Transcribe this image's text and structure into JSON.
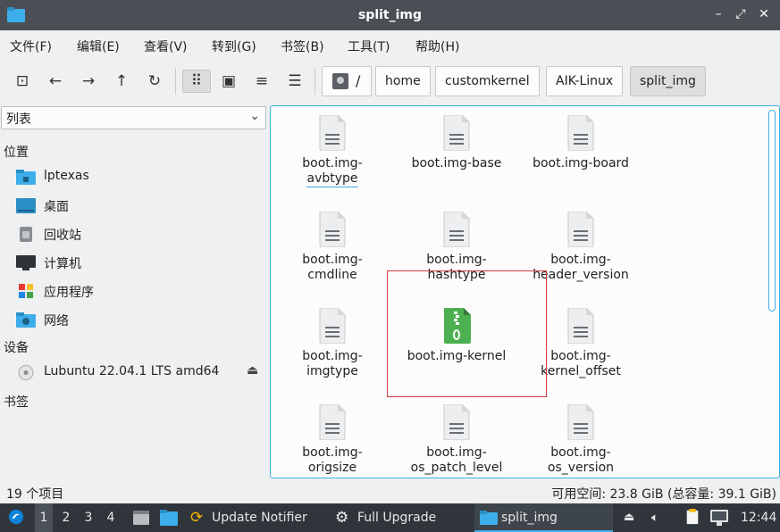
{
  "window": {
    "title": "split_img",
    "icon": "folder-icon",
    "controls": [
      "minimize-icon",
      "maximize-icon",
      "close-icon"
    ],
    "control_glyphs": [
      "–",
      "⤢",
      "✕"
    ]
  },
  "menu": {
    "items": [
      "文件(F)",
      "编辑(E)",
      "查看(V)",
      "转到(G)",
      "书签(B)",
      "工具(T)",
      "帮助(H)"
    ]
  },
  "toolbar": {
    "buttons": [
      {
        "name": "new-tab-icon",
        "glyph": "⊡"
      },
      {
        "name": "back-arrow-icon",
        "glyph": "←"
      },
      {
        "name": "forward-arrow-icon",
        "glyph": "→"
      },
      {
        "name": "up-arrow-icon",
        "glyph": "↑"
      },
      {
        "name": "reload-icon",
        "glyph": "↻"
      },
      {
        "name": "icon-view-icon",
        "glyph": "⠿"
      },
      {
        "name": "thumbnail-view-icon",
        "glyph": "▣"
      },
      {
        "name": "compact-view-icon",
        "glyph": "≡"
      },
      {
        "name": "detailed-list-view-icon",
        "glyph": "☰"
      }
    ],
    "breadcrumb": {
      "root_glyph": "/",
      "parts": [
        "home",
        "customkernel",
        "AIK-Linux",
        "split_img"
      ]
    }
  },
  "sidebar": {
    "mode_select": "列表",
    "places_header": "位置",
    "places": [
      {
        "label": "lptexas",
        "icon": "home-folder-icon"
      },
      {
        "label": "桌面",
        "icon": "desktop-icon"
      },
      {
        "label": "回收站",
        "icon": "trash-icon"
      },
      {
        "label": "计算机",
        "icon": "computer-icon"
      },
      {
        "label": "应用程序",
        "icon": "applications-icon"
      },
      {
        "label": "网络",
        "icon": "network-icon"
      }
    ],
    "devices_header": "设备",
    "devices": [
      {
        "label": "Lubuntu 22.04.1 LTS amd64",
        "icon": "optical-disc-icon",
        "eject_icon": "eject-icon",
        "eject_glyph": "⏏"
      }
    ],
    "bookmarks_header": "书签"
  },
  "files": [
    {
      "lines": [
        "boot.img-",
        "avbtype"
      ],
      "type": "text",
      "focused": true
    },
    {
      "lines": [
        "boot.img-base"
      ],
      "type": "text"
    },
    {
      "lines": [
        "boot.img-board"
      ],
      "type": "text"
    },
    {
      "lines": [
        "boot.img-",
        "cmdline"
      ],
      "type": "text"
    },
    {
      "lines": [
        "boot.img-",
        "hashtype"
      ],
      "type": "text"
    },
    {
      "lines": [
        "boot.img-",
        "header_version"
      ],
      "type": "text"
    },
    {
      "lines": [
        "boot.img-",
        "imgtype"
      ],
      "type": "text"
    },
    {
      "lines": [
        "boot.img-kernel"
      ],
      "type": "archive"
    },
    {
      "lines": [
        "boot.img-",
        "kernel_offset"
      ],
      "type": "text"
    },
    {
      "lines": [
        "boot.img-",
        "origsize"
      ],
      "type": "text"
    },
    {
      "lines": [
        "boot.img-",
        "os_patch_level"
      ],
      "type": "text"
    },
    {
      "lines": [
        "boot.img-",
        "os_version"
      ],
      "type": "text"
    }
  ],
  "status": {
    "count": "19 个项目",
    "free_space": "可用空间: 23.8 GiB (总容量: 39.1 GiB)"
  },
  "taskbar": {
    "workspaces": [
      "1",
      "2",
      "3",
      "4"
    ],
    "tasks": [
      {
        "label": "Update Notifier",
        "icon": "update-notifier-icon"
      },
      {
        "label": "Full Upgrade",
        "icon": "gear-icon"
      },
      {
        "label": "split_img",
        "icon": "folder-icon"
      }
    ],
    "clock": "12:44"
  },
  "colors": {
    "accent": "#3daee9",
    "highlight_box": "#d63a3a",
    "archive_green": "#4caf50"
  }
}
